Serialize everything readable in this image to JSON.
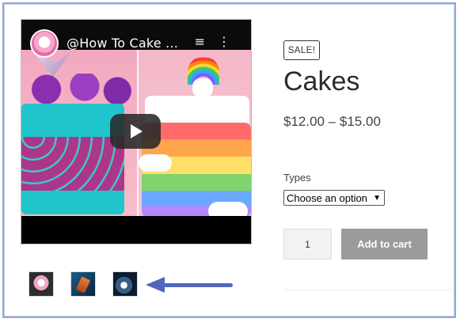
{
  "product_image": {
    "video": {
      "channel_title": "@How To Cake ...",
      "menu_icon": "playlist-icon",
      "more_icon": "more-vert-icon",
      "play_icon": "play-icon"
    },
    "thumbnails": [
      "thumbnail-cake",
      "thumbnail-sunset",
      "thumbnail-landscape"
    ],
    "annotation_arrow_color": "#5067bf"
  },
  "product": {
    "badge": "SALE!",
    "title": "Cakes",
    "price": "$12.00 – $15.00",
    "types_label": "Types",
    "types_select_value": "Choose an option",
    "quantity": "1",
    "add_to_cart": "Add to cart"
  },
  "colors": {
    "button_disabled": "#9b9b9b",
    "frame_border": "#8ea6d6"
  }
}
